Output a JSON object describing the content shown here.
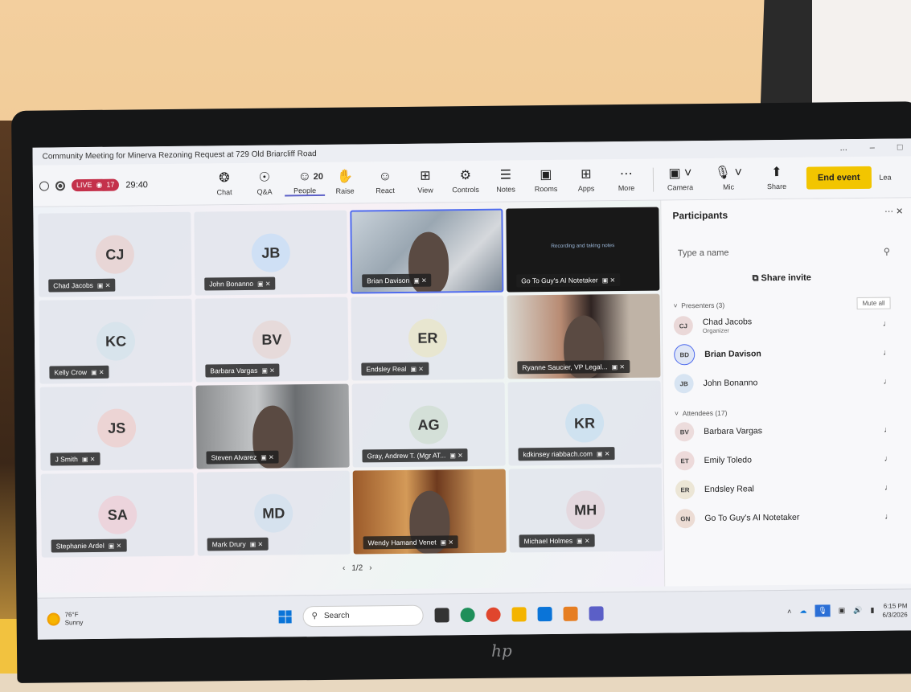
{
  "window": {
    "title": "Community Meeting for Minerva Rezoning Request at 729 Old Briarcliff Road",
    "controls": [
      "...",
      "–",
      "□"
    ]
  },
  "toolbar": {
    "live_label": "LIVE",
    "viewer_count": "17",
    "timer": "29:40",
    "buttons": [
      {
        "label": "Chat",
        "icon": "chat-icon",
        "glyph": "❂"
      },
      {
        "label": "Q&A",
        "icon": "qna-icon",
        "glyph": "☉"
      },
      {
        "label": "People",
        "icon": "people-icon",
        "glyph": "☺",
        "count": "20"
      },
      {
        "label": "Raise",
        "icon": "hand-icon",
        "glyph": "✋"
      },
      {
        "label": "React",
        "icon": "smile-icon",
        "glyph": "☺"
      },
      {
        "label": "View",
        "icon": "grid-icon",
        "glyph": "⊞"
      },
      {
        "label": "Controls",
        "icon": "controls-icon",
        "glyph": "⚙"
      },
      {
        "label": "Notes",
        "icon": "notes-icon",
        "glyph": "☰"
      },
      {
        "label": "Rooms",
        "icon": "rooms-icon",
        "glyph": "▣"
      },
      {
        "label": "Apps",
        "icon": "apps-icon",
        "glyph": "⊞"
      },
      {
        "label": "More",
        "icon": "more-icon",
        "glyph": "⋯"
      }
    ],
    "camera_label": "Camera",
    "mic_label": "Mic",
    "share_label": "Share",
    "end_event_label": "End event",
    "leave_label": "Lea"
  },
  "tiles": [
    {
      "initials": "CJ",
      "name": "Chad Jacobs",
      "color": "#e8d6d6",
      "type": "avatar"
    },
    {
      "initials": "JB",
      "name": "John Bonanno",
      "color": "#cfe0f5",
      "type": "avatar"
    },
    {
      "name": "Brian Davison",
      "type": "video"
    },
    {
      "name": "Go To Guy's AI Notetaker",
      "type": "video",
      "caption": "Recording and taking notes"
    },
    {
      "initials": "KC",
      "name": "Kelly Crow",
      "color": "#d8e4ec",
      "type": "avatar"
    },
    {
      "initials": "BV",
      "name": "Barbara Vargas",
      "color": "#e6dada",
      "type": "avatar"
    },
    {
      "initials": "ER",
      "name": "Endsley Real",
      "color": "#e8e6d0",
      "type": "avatar"
    },
    {
      "name": "Ryanne Saucier, VP Legal...",
      "type": "video"
    },
    {
      "initials": "JS",
      "name": "J Smith",
      "color": "#ecd4d4",
      "type": "avatar"
    },
    {
      "name": "Steven Alvarez",
      "type": "video"
    },
    {
      "initials": "AG",
      "name": "Gray, Andrew T. (Mgr AT...",
      "color": "#d4e0d8",
      "type": "avatar"
    },
    {
      "initials": "KR",
      "name": "kdkinsey riabbach.com",
      "color": "#cfe2f0",
      "type": "avatar"
    },
    {
      "initials": "SA",
      "name": "Stephanie Ardel",
      "color": "#ecd4dc",
      "type": "avatar"
    },
    {
      "initials": "MD",
      "name": "Mark Drury",
      "color": "#d6e2ee",
      "type": "avatar"
    },
    {
      "name": "Wendy Hamand Venet",
      "type": "video"
    },
    {
      "initials": "MH",
      "name": "Michael Holmes",
      "color": "#e4d8de",
      "type": "avatar"
    }
  ],
  "pager": {
    "text": "1/2"
  },
  "panel": {
    "title": "Participants",
    "search_placeholder": "Type a name",
    "share_invite": "Share invite",
    "presenters_header": "Presenters (3)",
    "mute_all": "Mute all",
    "presenters": [
      {
        "initials": "CJ",
        "name": "Chad Jacobs",
        "role": "Organizer",
        "color": "#ead8d8"
      },
      {
        "initials": "BD",
        "name": "Brian Davison",
        "role": "",
        "color": "#dfe6f6"
      },
      {
        "initials": "JB",
        "name": "John Bonanno",
        "role": "",
        "color": "#d7e4f2"
      }
    ],
    "attendees_header": "Attendees (17)",
    "attendees": [
      {
        "initials": "BV",
        "name": "Barbara Vargas",
        "color": "#ecdcdc"
      },
      {
        "initials": "ET",
        "name": "Emily Toledo",
        "color": "#eddada"
      },
      {
        "initials": "ER",
        "name": "Endsley Real",
        "color": "#ece6d6"
      },
      {
        "initials": "GN",
        "name": "Go To Guy's AI Notetaker",
        "color": "#ecdcd4"
      }
    ]
  },
  "taskbar": {
    "temp": "76°F",
    "weather": "Sunny",
    "search": "Search",
    "time": "6:15 PM",
    "date": "6/3/2026"
  }
}
